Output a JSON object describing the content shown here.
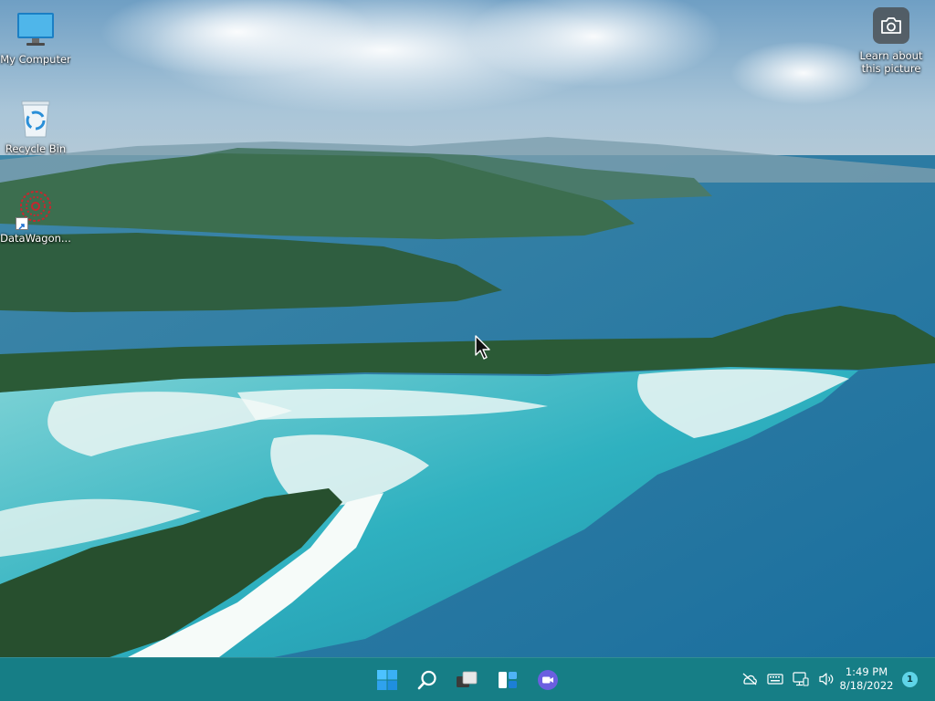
{
  "desktop": {
    "icons": [
      {
        "label": "My Computer",
        "icon": "monitor-icon"
      },
      {
        "label": "Recycle Bin",
        "icon": "recycle-bin-icon"
      },
      {
        "label": "DataWagon...",
        "icon": "datawagon-icon"
      }
    ],
    "spotlight": {
      "label_line1": "Learn about",
      "label_line2": "this picture",
      "icon": "camera-icon"
    }
  },
  "taskbar": {
    "color": "#167e86",
    "apps": [
      {
        "name": "Start",
        "icon": "windows-logo-icon"
      },
      {
        "name": "Search",
        "icon": "search-icon"
      },
      {
        "name": "Task View",
        "icon": "task-view-icon"
      },
      {
        "name": "Widgets",
        "icon": "widgets-icon"
      },
      {
        "name": "Chat",
        "icon": "chat-icon"
      }
    ],
    "tray": [
      "cloud-off-icon",
      "keyboard-icon",
      "network-icon",
      "volume-icon"
    ],
    "clock": {
      "time": "1:49 PM",
      "date": "8/18/2022"
    },
    "notifications": {
      "count": "1",
      "color": "#5fd4e8"
    }
  }
}
